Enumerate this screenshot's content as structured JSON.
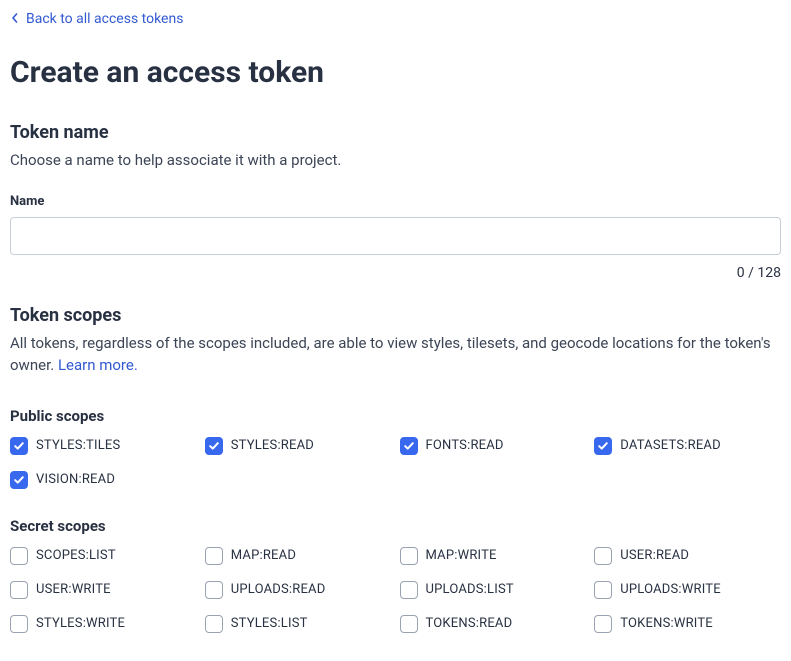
{
  "back_link": "Back to all access tokens",
  "page_title": "Create an access token",
  "token_name_section": {
    "title": "Token name",
    "desc": "Choose a name to help associate it with a project.",
    "field_label": "Name",
    "char_count": "0 / 128"
  },
  "token_scopes_section": {
    "title": "Token scopes",
    "desc_prefix": "All tokens, regardless of the scopes included, are able to view styles, tilesets, and geocode locations for the token's owner. ",
    "learn_more": "Learn more."
  },
  "public_scopes": {
    "title": "Public scopes",
    "items": [
      {
        "label": "STYLES:TILES",
        "checked": true
      },
      {
        "label": "STYLES:READ",
        "checked": true
      },
      {
        "label": "FONTS:READ",
        "checked": true
      },
      {
        "label": "DATASETS:READ",
        "checked": true
      },
      {
        "label": "VISION:READ",
        "checked": true
      }
    ]
  },
  "secret_scopes": {
    "title": "Secret scopes",
    "items": [
      {
        "label": "SCOPES:LIST",
        "checked": false
      },
      {
        "label": "MAP:READ",
        "checked": false
      },
      {
        "label": "MAP:WRITE",
        "checked": false
      },
      {
        "label": "USER:READ",
        "checked": false
      },
      {
        "label": "USER:WRITE",
        "checked": false
      },
      {
        "label": "UPLOADS:READ",
        "checked": false
      },
      {
        "label": "UPLOADS:LIST",
        "checked": false
      },
      {
        "label": "UPLOADS:WRITE",
        "checked": false
      },
      {
        "label": "STYLES:WRITE",
        "checked": false
      },
      {
        "label": "STYLES:LIST",
        "checked": false
      },
      {
        "label": "TOKENS:READ",
        "checked": false
      },
      {
        "label": "TOKENS:WRITE",
        "checked": false
      }
    ]
  }
}
